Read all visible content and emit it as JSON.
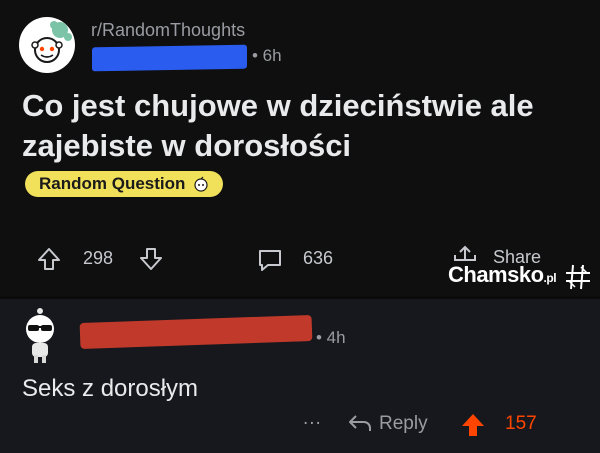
{
  "post": {
    "subreddit": "r/RandomThoughts",
    "age": "• 6h",
    "title": "Co jest chujowe w dzieciństwie ale zajebiste w dorosłości",
    "flair": "Random Question",
    "upvotes": "298",
    "comments": "636",
    "share_label": "Share"
  },
  "watermark": {
    "brand": "Chamsko",
    "tld": ".pl"
  },
  "comment": {
    "age": "• 4h",
    "text": "Seks z dorosłym",
    "more": "...",
    "reply_label": "Reply",
    "score": "157"
  },
  "colors": {
    "flair_bg": "#f1e05a",
    "upvote_active": "#ff4500",
    "redaction_blue": "#2b5cf0",
    "redaction_red": "#c0392b"
  }
}
